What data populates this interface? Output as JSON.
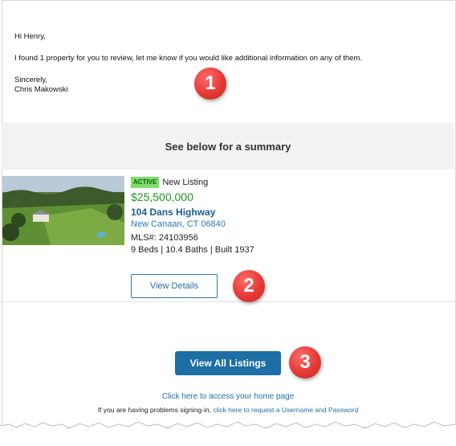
{
  "message": {
    "greeting": "Hi Henry,",
    "body": "I found 1 property for you to review, let me know if you would like additional information on any of them.",
    "closing": "Sincerely,",
    "signature": "Chris Makowski"
  },
  "summary_heading": "See below for a summary",
  "listing": {
    "status_badge": "ACTIVE",
    "status_text": "New Listing",
    "price": "$25,500,000",
    "street": "104 Dans Highway",
    "city_line": "New Canaan, CT 06840",
    "mls": "MLS#: 24103956",
    "specs": "9 Beds | 10.4 Baths | Built 1937",
    "view_details_label": "View Details"
  },
  "actions": {
    "view_all_label": "View All Listings",
    "home_link": "Click here to access your home page",
    "signin_prefix": "If you are having problems signing-in,",
    "signin_link": "click here to request a Username and Password"
  },
  "markers": [
    "1",
    "2",
    "3"
  ],
  "colors": {
    "badge_bg": "#7ee06a",
    "price": "#1a9a1a",
    "link": "#1d6fb0",
    "button_primary": "#1c6ea4",
    "marker": "#e53935"
  }
}
